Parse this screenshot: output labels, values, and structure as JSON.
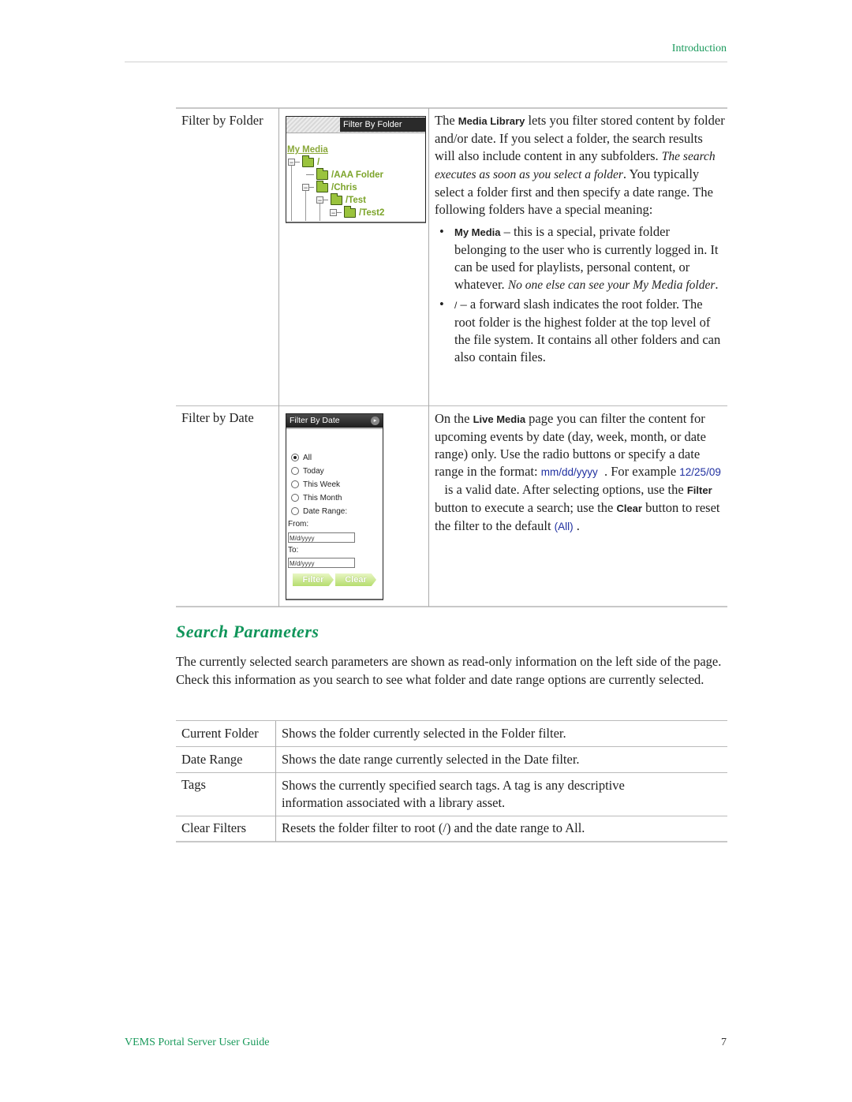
{
  "header": {
    "section": "Introduction"
  },
  "filter_table": {
    "rows": [
      {
        "label": "Filter by Folder",
        "widget": {
          "title": "Filter By Folder",
          "root_link": "My Media",
          "tree": [
            {
              "name": "/",
              "expander": "−"
            },
            {
              "name": "/AAA Folder",
              "expander": ""
            },
            {
              "name": "/Chris",
              "expander": "−"
            },
            {
              "name": "/Test",
              "expander": "−"
            },
            {
              "name": "/Test2",
              "expander": "−"
            }
          ]
        },
        "desc": {
          "p1_a": "The ",
          "p1_b": "Media Library",
          "p1_c": " lets you filter stored content by folder and/or date. If you select a folder, the search results will also include content in any subfolders. ",
          "p1_it": "The search executes as soon as you select a folder",
          "p1_d": ". You typically select a folder first and then specify a date range. The following folders have a special meaning:",
          "bullets": [
            {
              "bullet": "•",
              "term": "My Media",
              "text": " – this is a special, private folder belonging to the user who is currently logged in. It can be used for playlists, personal content, or whatever. ",
              "italic": "No one else can see your My Media folder",
              "end": "."
            },
            {
              "bullet": "•",
              "term": "/",
              "text": " – a forward slash indicates the root folder. The root folder is the highest folder at the top level of the file system. It contains all other folders and can also contain files.",
              "italic": "",
              "end": ""
            }
          ]
        }
      },
      {
        "label": "Filter by Date",
        "widget": {
          "title": "Filter By Date",
          "arrow": "▸",
          "options": [
            {
              "label": "All",
              "selected": true
            },
            {
              "label": "Today",
              "selected": false
            },
            {
              "label": "This Week",
              "selected": false
            },
            {
              "label": "This Month",
              "selected": false
            },
            {
              "label": "Date Range:",
              "selected": false
            }
          ],
          "from_label": "From:",
          "from_placeholder": "M/d/yyyy",
          "to_label": "To:",
          "to_placeholder": "M/d/yyyy",
          "filter_button": "Filter",
          "clear_button": "Clear"
        },
        "desc": {
          "a": "On the ",
          "b": "Live Media",
          "c": " page you can filter the content for upcoming events by date (day, week, month, or date range) only. Use the radio buttons or specify a date range in the format: ",
          "fmt": "mm/dd/yyyy",
          "d": "  . For example ",
          "example": "12/25/09",
          "e": "   is a valid date. After selecting options, use the ",
          "filter": "Filter",
          "f": " button to execute a search; use the ",
          "clear": "Clear",
          "g": " button to reset the filter to the default ",
          "all": "(All)",
          "h": " ."
        }
      }
    ]
  },
  "search_parameters": {
    "title": "Search Parameters",
    "paragraph": "The currently selected search parameters are shown as read-only information on the left side of the page. Check this information as you search to see what folder and date range options are currently selected.",
    "rows": [
      {
        "term": "Current Folder",
        "desc": "Shows the folder currently selected in the Folder filter."
      },
      {
        "term": "Date Range",
        "desc": "Shows the date range currently selected in the Date filter."
      },
      {
        "term": "Tags",
        "desc": "Shows the currently specified search tags. A tag is any descriptive information associated with a library asset."
      },
      {
        "term": "Clear Filters",
        "desc": "Resets the folder filter to root (/) and the date range to All."
      }
    ]
  },
  "footer": {
    "title": "VEMS Portal Server User Guide",
    "page": "7"
  }
}
